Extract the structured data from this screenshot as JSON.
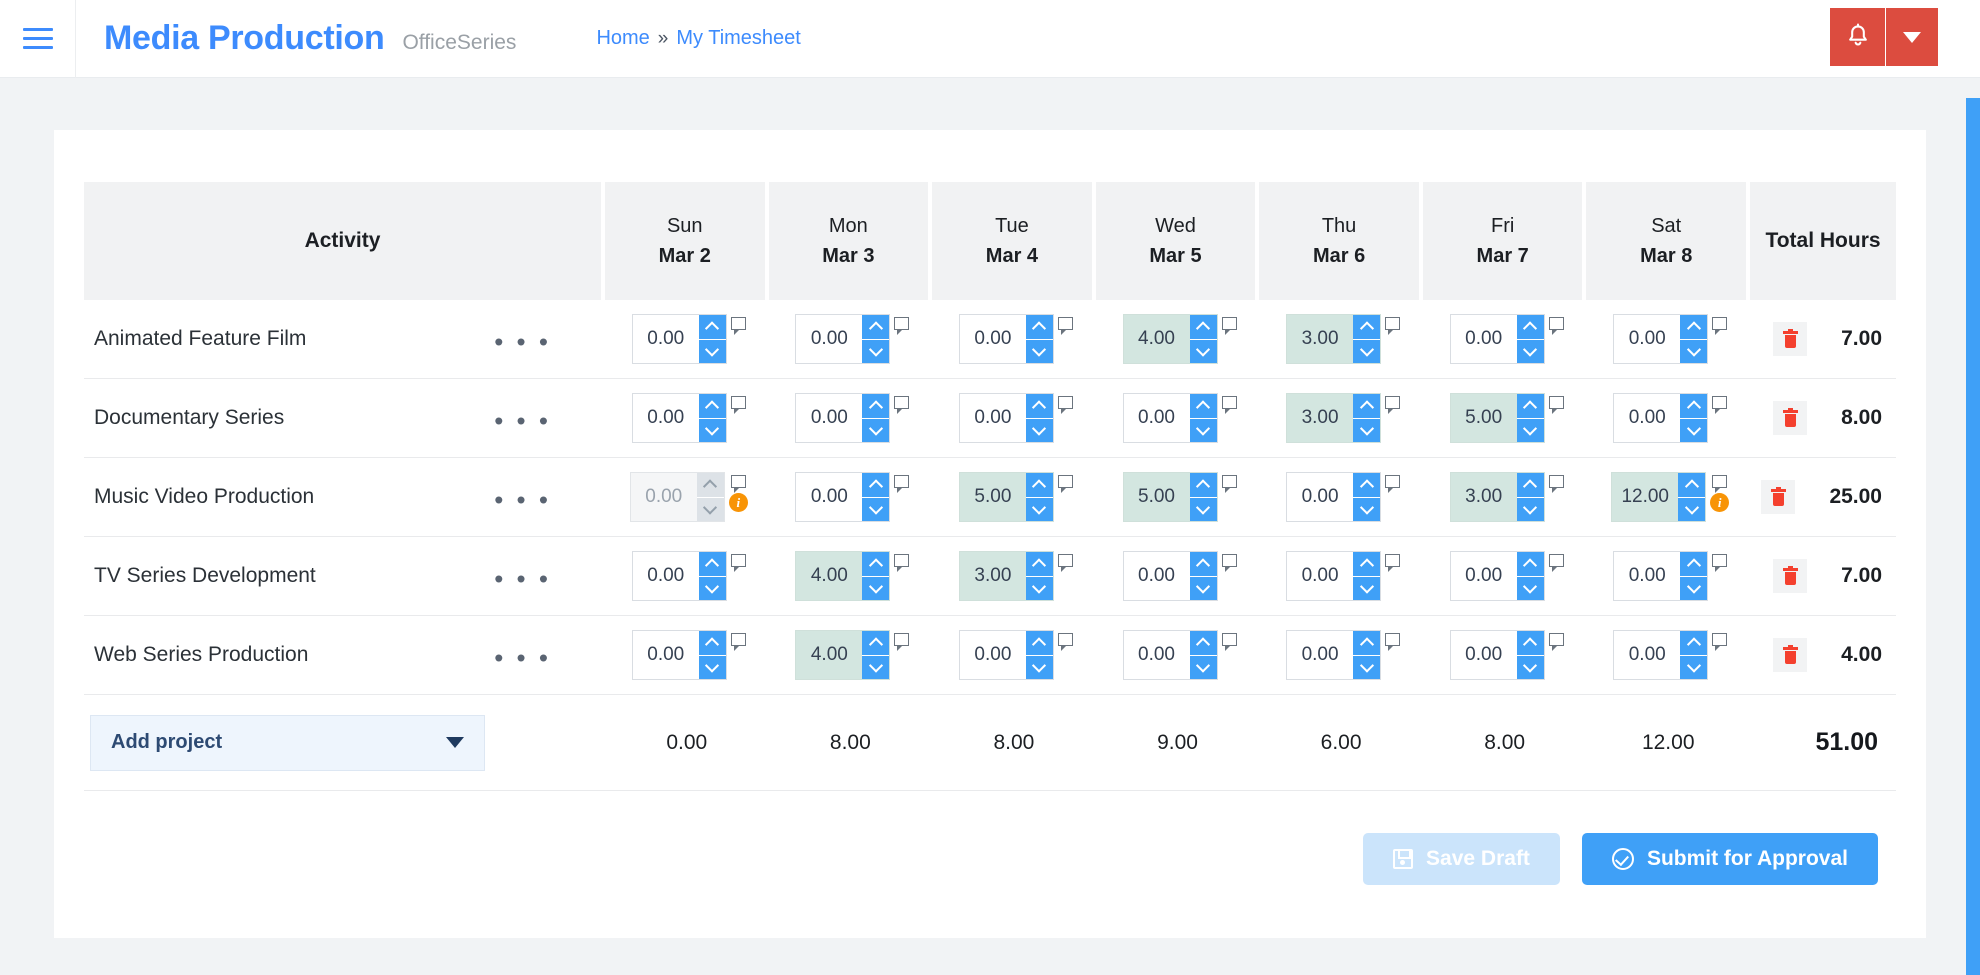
{
  "header": {
    "menu_icon": "hamburger-icon",
    "brand_title": "Media Production",
    "brand_subtitle": "OfficeSeries",
    "breadcrumb": {
      "home": "Home",
      "separator": "»",
      "current": "My Timesheet"
    },
    "notification_icon": "bell-icon",
    "notification_caret_icon": "chevron-down-icon",
    "accent_color": "#3d8bfd",
    "notification_color": "#dc4c3f"
  },
  "table": {
    "activity_header": "Activity",
    "total_header": "Total Hours",
    "days": [
      {
        "name": "Sun",
        "date": "Mar 2"
      },
      {
        "name": "Mon",
        "date": "Mar 3"
      },
      {
        "name": "Tue",
        "date": "Mar 4"
      },
      {
        "name": "Wed",
        "date": "Mar 5"
      },
      {
        "name": "Thu",
        "date": "Mar 6"
      },
      {
        "name": "Fri",
        "date": "Mar 7"
      },
      {
        "name": "Sat",
        "date": "Mar 8"
      }
    ],
    "rows": [
      {
        "activity": "Animated Feature Film",
        "menu": "• • •",
        "cells": [
          {
            "value": "0.00",
            "filled": false,
            "disabled": false,
            "info": false
          },
          {
            "value": "0.00",
            "filled": false,
            "disabled": false,
            "info": false
          },
          {
            "value": "0.00",
            "filled": false,
            "disabled": false,
            "info": false
          },
          {
            "value": "4.00",
            "filled": true,
            "disabled": false,
            "info": false
          },
          {
            "value": "3.00",
            "filled": true,
            "disabled": false,
            "info": false
          },
          {
            "value": "0.00",
            "filled": false,
            "disabled": false,
            "info": false
          },
          {
            "value": "0.00",
            "filled": false,
            "disabled": false,
            "info": false
          }
        ],
        "total": "7.00"
      },
      {
        "activity": "Documentary Series",
        "menu": "• • •",
        "cells": [
          {
            "value": "0.00",
            "filled": false,
            "disabled": false,
            "info": false
          },
          {
            "value": "0.00",
            "filled": false,
            "disabled": false,
            "info": false
          },
          {
            "value": "0.00",
            "filled": false,
            "disabled": false,
            "info": false
          },
          {
            "value": "0.00",
            "filled": false,
            "disabled": false,
            "info": false
          },
          {
            "value": "3.00",
            "filled": true,
            "disabled": false,
            "info": false
          },
          {
            "value": "5.00",
            "filled": true,
            "disabled": false,
            "info": false
          },
          {
            "value": "0.00",
            "filled": false,
            "disabled": false,
            "info": false
          }
        ],
        "total": "8.00"
      },
      {
        "activity": "Music Video Production",
        "menu": "• • •",
        "cells": [
          {
            "value": "0.00",
            "filled": false,
            "disabled": true,
            "info": true
          },
          {
            "value": "0.00",
            "filled": false,
            "disabled": false,
            "info": false
          },
          {
            "value": "5.00",
            "filled": true,
            "disabled": false,
            "info": false
          },
          {
            "value": "5.00",
            "filled": true,
            "disabled": false,
            "info": false
          },
          {
            "value": "0.00",
            "filled": false,
            "disabled": false,
            "info": false
          },
          {
            "value": "3.00",
            "filled": true,
            "disabled": false,
            "info": false
          },
          {
            "value": "12.00",
            "filled": true,
            "disabled": false,
            "info": true
          }
        ],
        "total": "25.00"
      },
      {
        "activity": "TV Series Development",
        "menu": "• • •",
        "cells": [
          {
            "value": "0.00",
            "filled": false,
            "disabled": false,
            "info": false
          },
          {
            "value": "4.00",
            "filled": true,
            "disabled": false,
            "info": false
          },
          {
            "value": "3.00",
            "filled": true,
            "disabled": false,
            "info": false
          },
          {
            "value": "0.00",
            "filled": false,
            "disabled": false,
            "info": false
          },
          {
            "value": "0.00",
            "filled": false,
            "disabled": false,
            "info": false
          },
          {
            "value": "0.00",
            "filled": false,
            "disabled": false,
            "info": false
          },
          {
            "value": "0.00",
            "filled": false,
            "disabled": false,
            "info": false
          }
        ],
        "total": "7.00"
      },
      {
        "activity": "Web Series Production",
        "menu": "• • •",
        "cells": [
          {
            "value": "0.00",
            "filled": false,
            "disabled": false,
            "info": false
          },
          {
            "value": "4.00",
            "filled": true,
            "disabled": false,
            "info": false
          },
          {
            "value": "0.00",
            "filled": false,
            "disabled": false,
            "info": false
          },
          {
            "value": "0.00",
            "filled": false,
            "disabled": false,
            "info": false
          },
          {
            "value": "0.00",
            "filled": false,
            "disabled": false,
            "info": false
          },
          {
            "value": "0.00",
            "filled": false,
            "disabled": false,
            "info": false
          },
          {
            "value": "0.00",
            "filled": false,
            "disabled": false,
            "info": false
          }
        ],
        "total": "4.00"
      }
    ],
    "totals_row": {
      "add_project_label": "Add project",
      "day_totals": [
        "0.00",
        "8.00",
        "8.00",
        "9.00",
        "6.00",
        "8.00",
        "12.00"
      ],
      "grand_total": "51.00"
    },
    "delete_icon": "trash-icon",
    "comment_icon": "comment-flag-icon",
    "info_icon": "info-icon",
    "filled_cell_color": "#d3e6e0",
    "spinner_color": "#3fa0f7"
  },
  "footer": {
    "save_label": "Save Draft",
    "save_icon": "save-disk-icon",
    "save_disabled": true,
    "submit_label": "Submit for Approval",
    "submit_icon": "check-circle-icon"
  }
}
